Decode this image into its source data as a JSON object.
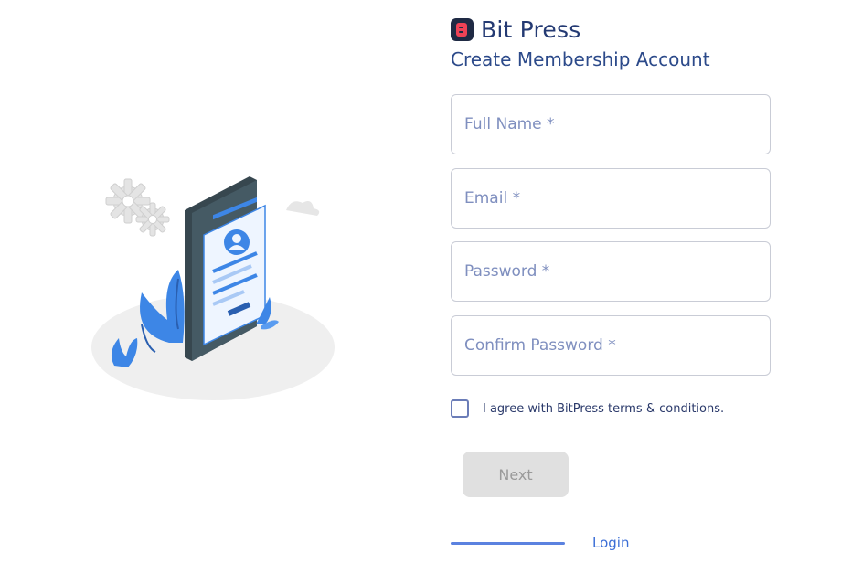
{
  "brand": {
    "name": "Bit Press",
    "logo_icon": "bitpress-logo-icon"
  },
  "header": {
    "subtitle": "Create Membership Account"
  },
  "form": {
    "full_name": {
      "placeholder": "Full Name *",
      "value": ""
    },
    "email": {
      "placeholder": "Email *",
      "value": ""
    },
    "password": {
      "placeholder": "Password *",
      "value": ""
    },
    "confirm_password": {
      "placeholder": "Confirm Password *",
      "value": ""
    },
    "agree": {
      "label": "I agree with BitPress terms & conditions.",
      "checked": false
    },
    "next_label": "Next"
  },
  "footer": {
    "login_label": "Login"
  },
  "colors": {
    "accent": "#3b6ed6",
    "brand_dark": "#1f2a44",
    "brand_red": "#ef4256",
    "disabled_bg": "#e0e0e0"
  },
  "illustration": {
    "icon": "mobile-signup-illustration"
  }
}
